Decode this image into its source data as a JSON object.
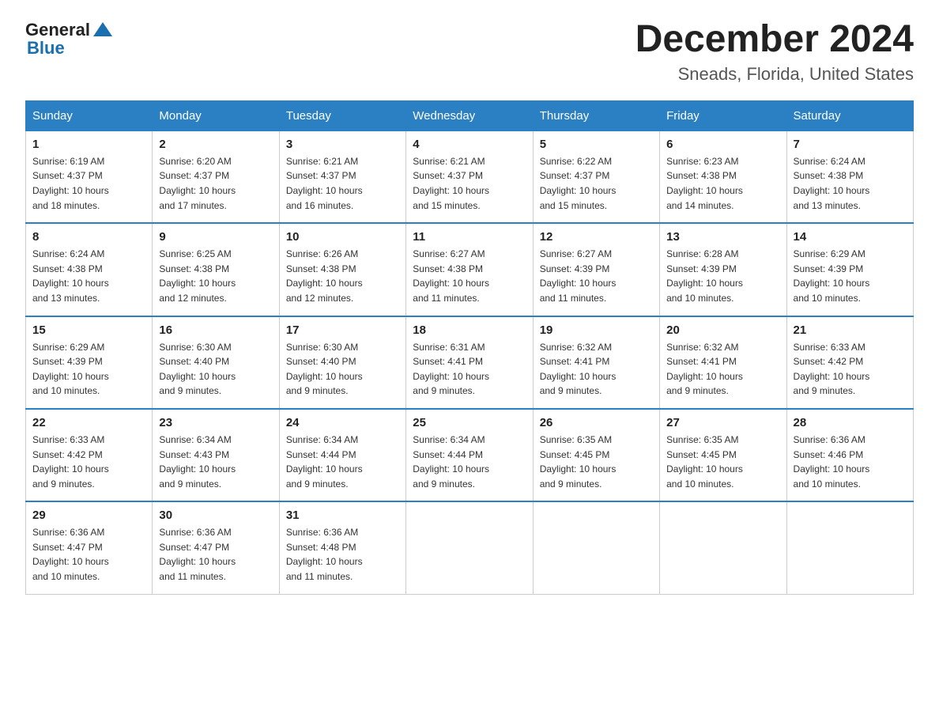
{
  "header": {
    "logo_general": "General",
    "logo_blue": "Blue",
    "month": "December 2024",
    "location": "Sneads, Florida, United States"
  },
  "weekdays": [
    "Sunday",
    "Monday",
    "Tuesday",
    "Wednesday",
    "Thursday",
    "Friday",
    "Saturday"
  ],
  "weeks": [
    [
      {
        "day": "1",
        "sunrise": "6:19 AM",
        "sunset": "4:37 PM",
        "daylight": "10 hours and 18 minutes."
      },
      {
        "day": "2",
        "sunrise": "6:20 AM",
        "sunset": "4:37 PM",
        "daylight": "10 hours and 17 minutes."
      },
      {
        "day": "3",
        "sunrise": "6:21 AM",
        "sunset": "4:37 PM",
        "daylight": "10 hours and 16 minutes."
      },
      {
        "day": "4",
        "sunrise": "6:21 AM",
        "sunset": "4:37 PM",
        "daylight": "10 hours and 15 minutes."
      },
      {
        "day": "5",
        "sunrise": "6:22 AM",
        "sunset": "4:37 PM",
        "daylight": "10 hours and 15 minutes."
      },
      {
        "day": "6",
        "sunrise": "6:23 AM",
        "sunset": "4:38 PM",
        "daylight": "10 hours and 14 minutes."
      },
      {
        "day": "7",
        "sunrise": "6:24 AM",
        "sunset": "4:38 PM",
        "daylight": "10 hours and 13 minutes."
      }
    ],
    [
      {
        "day": "8",
        "sunrise": "6:24 AM",
        "sunset": "4:38 PM",
        "daylight": "10 hours and 13 minutes."
      },
      {
        "day": "9",
        "sunrise": "6:25 AM",
        "sunset": "4:38 PM",
        "daylight": "10 hours and 12 minutes."
      },
      {
        "day": "10",
        "sunrise": "6:26 AM",
        "sunset": "4:38 PM",
        "daylight": "10 hours and 12 minutes."
      },
      {
        "day": "11",
        "sunrise": "6:27 AM",
        "sunset": "4:38 PM",
        "daylight": "10 hours and 11 minutes."
      },
      {
        "day": "12",
        "sunrise": "6:27 AM",
        "sunset": "4:39 PM",
        "daylight": "10 hours and 11 minutes."
      },
      {
        "day": "13",
        "sunrise": "6:28 AM",
        "sunset": "4:39 PM",
        "daylight": "10 hours and 10 minutes."
      },
      {
        "day": "14",
        "sunrise": "6:29 AM",
        "sunset": "4:39 PM",
        "daylight": "10 hours and 10 minutes."
      }
    ],
    [
      {
        "day": "15",
        "sunrise": "6:29 AM",
        "sunset": "4:39 PM",
        "daylight": "10 hours and 10 minutes."
      },
      {
        "day": "16",
        "sunrise": "6:30 AM",
        "sunset": "4:40 PM",
        "daylight": "10 hours and 9 minutes."
      },
      {
        "day": "17",
        "sunrise": "6:30 AM",
        "sunset": "4:40 PM",
        "daylight": "10 hours and 9 minutes."
      },
      {
        "day": "18",
        "sunrise": "6:31 AM",
        "sunset": "4:41 PM",
        "daylight": "10 hours and 9 minutes."
      },
      {
        "day": "19",
        "sunrise": "6:32 AM",
        "sunset": "4:41 PM",
        "daylight": "10 hours and 9 minutes."
      },
      {
        "day": "20",
        "sunrise": "6:32 AM",
        "sunset": "4:41 PM",
        "daylight": "10 hours and 9 minutes."
      },
      {
        "day": "21",
        "sunrise": "6:33 AM",
        "sunset": "4:42 PM",
        "daylight": "10 hours and 9 minutes."
      }
    ],
    [
      {
        "day": "22",
        "sunrise": "6:33 AM",
        "sunset": "4:42 PM",
        "daylight": "10 hours and 9 minutes."
      },
      {
        "day": "23",
        "sunrise": "6:34 AM",
        "sunset": "4:43 PM",
        "daylight": "10 hours and 9 minutes."
      },
      {
        "day": "24",
        "sunrise": "6:34 AM",
        "sunset": "4:44 PM",
        "daylight": "10 hours and 9 minutes."
      },
      {
        "day": "25",
        "sunrise": "6:34 AM",
        "sunset": "4:44 PM",
        "daylight": "10 hours and 9 minutes."
      },
      {
        "day": "26",
        "sunrise": "6:35 AM",
        "sunset": "4:45 PM",
        "daylight": "10 hours and 9 minutes."
      },
      {
        "day": "27",
        "sunrise": "6:35 AM",
        "sunset": "4:45 PM",
        "daylight": "10 hours and 10 minutes."
      },
      {
        "day": "28",
        "sunrise": "6:36 AM",
        "sunset": "4:46 PM",
        "daylight": "10 hours and 10 minutes."
      }
    ],
    [
      {
        "day": "29",
        "sunrise": "6:36 AM",
        "sunset": "4:47 PM",
        "daylight": "10 hours and 10 minutes."
      },
      {
        "day": "30",
        "sunrise": "6:36 AM",
        "sunset": "4:47 PM",
        "daylight": "10 hours and 11 minutes."
      },
      {
        "day": "31",
        "sunrise": "6:36 AM",
        "sunset": "4:48 PM",
        "daylight": "10 hours and 11 minutes."
      },
      null,
      null,
      null,
      null
    ]
  ],
  "labels": {
    "sunrise": "Sunrise:",
    "sunset": "Sunset:",
    "daylight": "Daylight:"
  }
}
